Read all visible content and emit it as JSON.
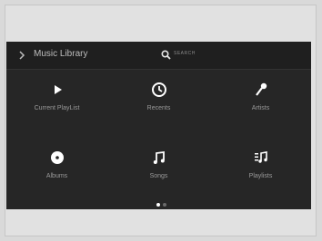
{
  "header": {
    "title": "Music Library",
    "search_label": "SEARCH",
    "back_icon": "chevron-right-icon",
    "search_icon": "search-icon"
  },
  "menu": {
    "items": [
      {
        "label": "Current PlayList",
        "icon": "play-icon"
      },
      {
        "label": "Recents",
        "icon": "clock-icon"
      },
      {
        "label": "Artists",
        "icon": "microphone-icon"
      },
      {
        "label": "Albums",
        "icon": "disc-icon"
      },
      {
        "label": "Songs",
        "icon": "music-note-icon"
      },
      {
        "label": "Playlists",
        "icon": "playlist-icon"
      }
    ]
  },
  "pager": {
    "pages": 2,
    "current": 1
  },
  "colors": {
    "screen_bg": "#262626",
    "icon": "#ffffff",
    "label": "#9a9a9a",
    "page_bg": "#d9d9d9"
  }
}
